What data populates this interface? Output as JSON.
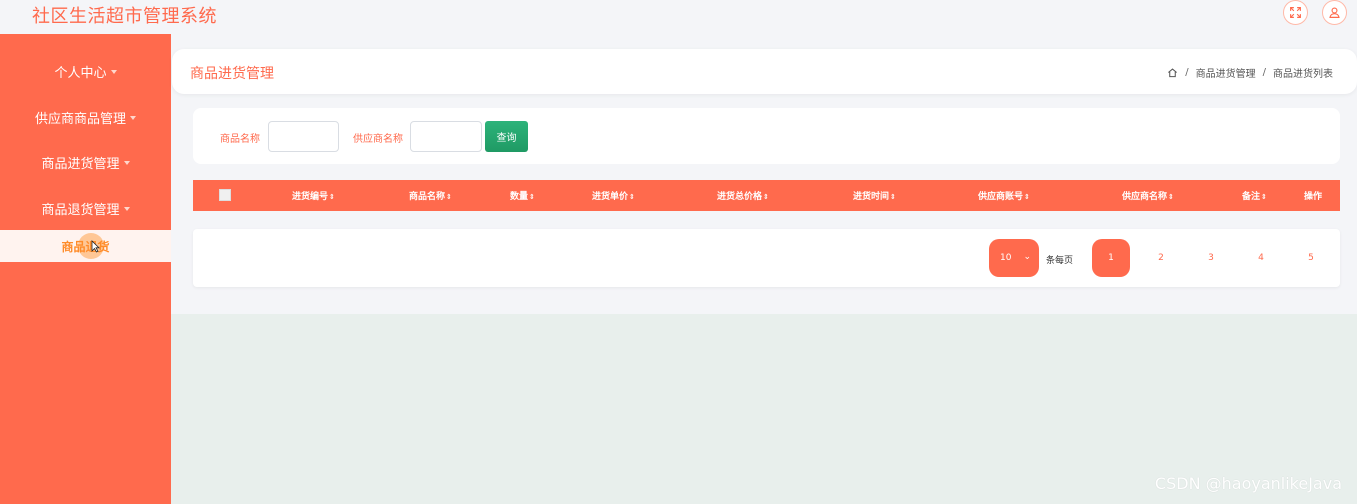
{
  "header": {
    "app_title": "社区生活超市管理系统",
    "icons": [
      "fullscreen-icon",
      "user-icon"
    ]
  },
  "sidebar": {
    "items": [
      {
        "label": "个人中心"
      },
      {
        "label": "供应商商品管理"
      },
      {
        "label": "商品进货管理"
      },
      {
        "label": "商品退货管理"
      }
    ],
    "active_sub": "商品退货"
  },
  "page": {
    "title": "商品进货管理",
    "breadcrumb": [
      "商品进货管理",
      "商品进货列表"
    ]
  },
  "search": {
    "product_label": "商品名称",
    "supplier_label": "供应商名称",
    "product_value": "",
    "supplier_value": "",
    "button_label": "查询"
  },
  "table": {
    "columns": [
      "进货编号",
      "商品名称",
      "数量",
      "进货单价",
      "进货总价格",
      "进货时间",
      "供应商账号",
      "供应商名称",
      "备注"
    ],
    "action_col": "操作",
    "sort_glyph": "⇕"
  },
  "pagination": {
    "page_size": "10",
    "per_page_label": "条每页",
    "pages": [
      "1",
      "2",
      "3",
      "4",
      "5"
    ],
    "current": "1"
  },
  "watermark": "CSDN @haoyanlikeJava",
  "colors": {
    "accent": "#ff6a4d",
    "button_green": "#1f9a64",
    "sidebar_sub_text": "#ff8c2a"
  }
}
